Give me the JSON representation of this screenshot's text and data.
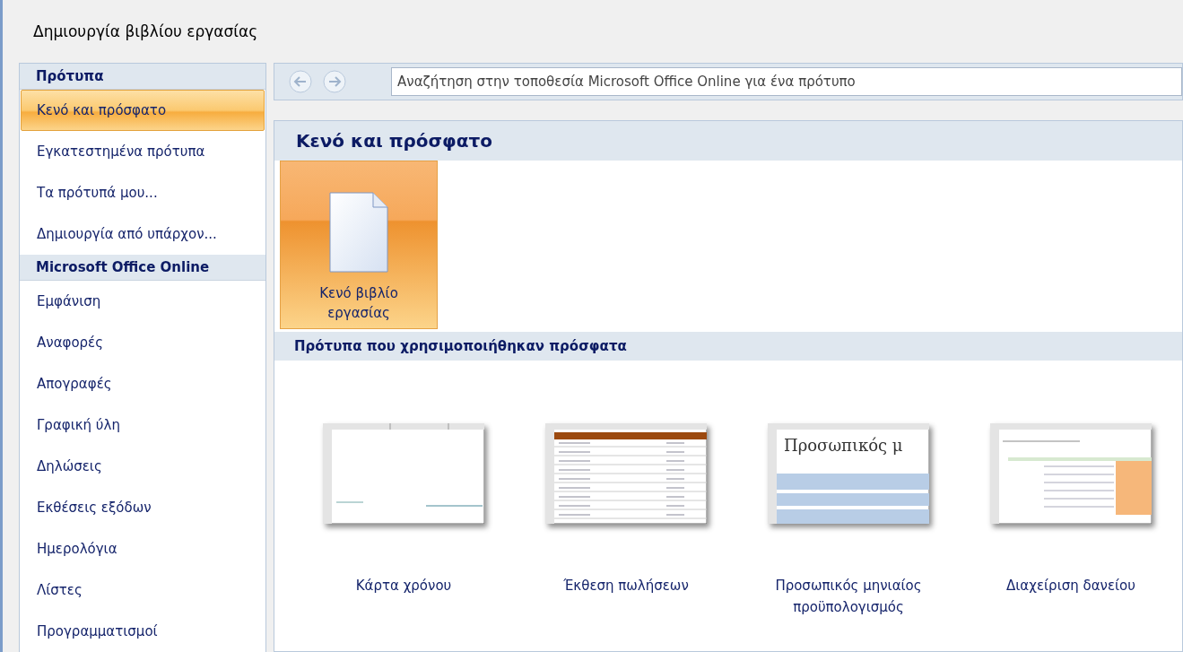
{
  "window": {
    "title": "Δημιουργία βιβλίου εργασίας"
  },
  "sidebar": {
    "sections": [
      {
        "title": "Πρότυπα",
        "items": [
          {
            "label": "Κενό και πρόσφατο",
            "selected": true
          },
          {
            "label": "Εγκατεστημένα πρότυπα",
            "selected": false
          },
          {
            "label": "Τα πρότυπά μου...",
            "selected": false
          },
          {
            "label": "Δημιουργία από υπάρχον...",
            "selected": false
          }
        ]
      },
      {
        "title": "Microsoft Office Online",
        "items": [
          {
            "label": "Εμφάνιση",
            "selected": false
          },
          {
            "label": "Αναφορές",
            "selected": false
          },
          {
            "label": "Απογραφές",
            "selected": false
          },
          {
            "label": "Γραφική ύλη",
            "selected": false
          },
          {
            "label": "Δηλώσεις",
            "selected": false
          },
          {
            "label": "Εκθέσεις εξόδων",
            "selected": false
          },
          {
            "label": "Ημερολόγια",
            "selected": false
          },
          {
            "label": "Λίστες",
            "selected": false
          },
          {
            "label": "Προγραμματισμοί",
            "selected": false
          }
        ]
      }
    ]
  },
  "search": {
    "placeholder": "Αναζήτηση στην τοποθεσία Microsoft Office Online για ένα πρότυπο"
  },
  "content": {
    "title": "Κενό και πρόσφατο",
    "blank_item": {
      "label": "Κενό βιβλίο εργασίας",
      "selected": true
    },
    "recent_title": "Πρότυπα που χρησιμοποιήθηκαν πρόσφατα",
    "recent": [
      {
        "kind": "timecard",
        "label": "Κάρτα χρόνου"
      },
      {
        "kind": "sales",
        "label": "Έκθεση πωλήσεων"
      },
      {
        "kind": "budget",
        "label": "Προσωπικός μηνιαίος προϋπολογισμός",
        "preview_title": "Προσωπικός μ"
      },
      {
        "kind": "loan",
        "label": "Διαχείριση δανείου"
      }
    ]
  }
}
